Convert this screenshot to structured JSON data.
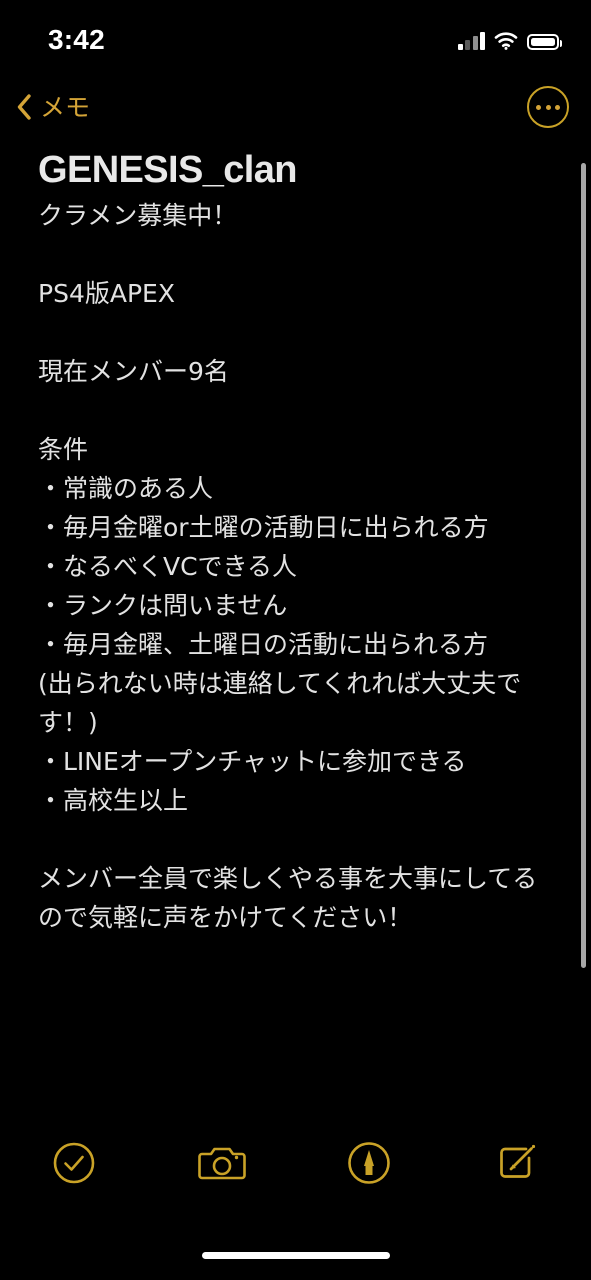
{
  "status_bar": {
    "time": "3:42",
    "signal_icon": "cellular-signal-icon",
    "signal_bars": 4,
    "wifi_icon": "wifi-icon",
    "battery_icon": "battery-icon"
  },
  "nav_bar": {
    "back_icon": "chevron-left-icon",
    "back_label": "メモ",
    "more_icon": "ellipsis-circle-icon",
    "accent_color": "#d4a437"
  },
  "note": {
    "title": "GENESIS_clan",
    "lines": [
      "クラメン募集中！",
      "",
      "PS4版APEX",
      "",
      "現在メンバー9名",
      "",
      "条件",
      "・常識のある人",
      "・毎月金曜or土曜の活動日に出られる方",
      "・なるべくVCできる人",
      "・ランクは問いません",
      "・毎月金曜、土曜日の活動に出られる方",
      "(出られない時は連絡してくれれば大丈夫で",
      "す！)",
      "・LINEオープンチャットに参加できる",
      "・高校生以上",
      "",
      "メンバー全員で楽しくやる事を大事にしてる",
      "ので気軽に声をかけてください！"
    ],
    "text_color": "#e2e2e2",
    "background_color": "#000000"
  },
  "scrollbar": {
    "name": "vertical-scroll-indicator"
  },
  "toolbar": {
    "items": [
      {
        "icon": "checkmark-circle-icon",
        "label": "チェックリスト"
      },
      {
        "icon": "camera-icon",
        "label": "カメラ"
      },
      {
        "icon": "markup-pen-circle-icon",
        "label": "マークアップ"
      },
      {
        "icon": "compose-icon",
        "label": "新規メモ"
      }
    ],
    "accent_color": "#c9a227"
  },
  "home_indicator": {
    "name": "home-indicator"
  }
}
